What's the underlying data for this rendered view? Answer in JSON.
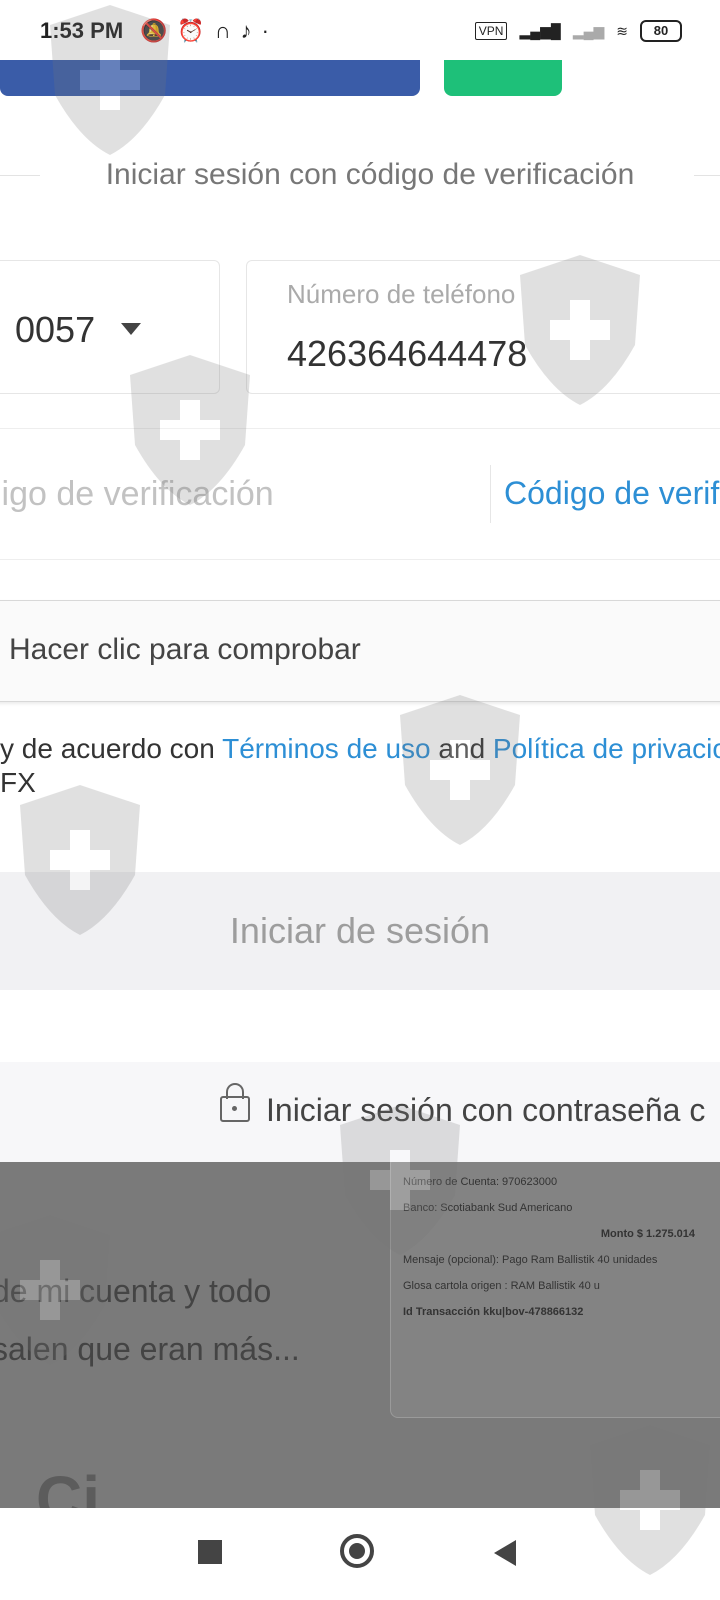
{
  "status_bar": {
    "time": "1:53 PM",
    "vpn": "VPN",
    "battery": "80",
    "icons": [
      "mute-icon",
      "alarm-icon",
      "headphones-icon",
      "tiktok-icon",
      "dot-icon",
      "signal-icon",
      "wifi-icon"
    ]
  },
  "top_buttons": {
    "facebook_color": "#3a5ca8",
    "green_color": "#1ec079"
  },
  "login_form": {
    "section_title": "Iniciar sesión con código de verificación",
    "country_code": "0057",
    "phone_label": "Número de teléfono",
    "phone_value": "426364644478",
    "code_placeholder": "ligo de verificación",
    "send_code_label": "Código de verif",
    "captcha_label": "Hacer clic para comprobar",
    "terms_prefix": "y de acuerdo con ",
    "terms_link": "Términos de uso",
    "terms_and": " and ",
    "privacy_link": "Política de privacio",
    "terms_line2": "FX",
    "login_button": "Iniciar de sesión",
    "password_login": "Iniciar sesión con contraseña c"
  },
  "background_content": {
    "snippet_line1": "de mi cuenta y todo",
    "snippet_line2": "salen que eran más...",
    "heading_partial": "Ci",
    "receipt": {
      "line1": "Número de Cuenta: 970623000",
      "line2": "Banco: Scotiabank Sud Americano",
      "line3": "Monto $ 1.275.014",
      "line4": "Mensaje (opcional): Pago Ram Ballistik 40 unidades",
      "line5": "Glosa cartola origen : RAM Ballistik 40 u",
      "line6": "Id Transacción kku|bov-478866132"
    }
  },
  "nav_bar": {
    "icons": [
      "recents-icon",
      "home-icon",
      "back-icon"
    ]
  }
}
